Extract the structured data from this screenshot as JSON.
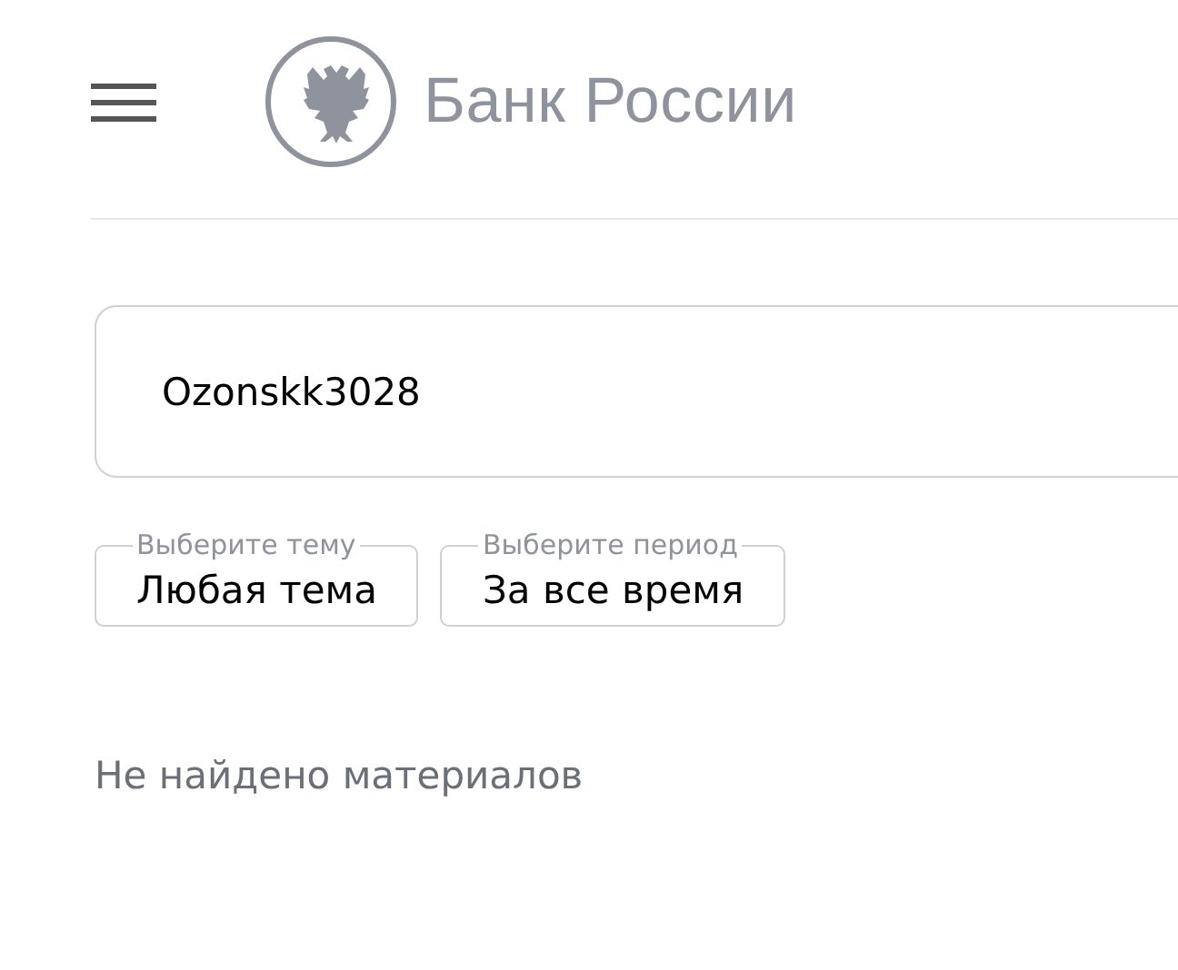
{
  "header": {
    "logo_text": "Банк России"
  },
  "search": {
    "value": "Ozonskk3028"
  },
  "filters": [
    {
      "label": "Выберите тему",
      "value": "Любая тема"
    },
    {
      "label": "Выберите период",
      "value": "За все время"
    }
  ],
  "results": {
    "message": "Не найдено материалов"
  }
}
